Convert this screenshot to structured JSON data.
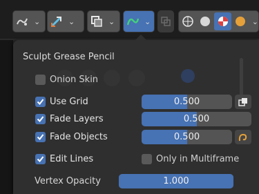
{
  "panel": {
    "title": "Sculpt Grease Pencil",
    "onion_skin": {
      "label": "Onion Skin",
      "checked": false
    },
    "use_grid": {
      "label": "Use Grid",
      "checked": true,
      "value": "0.500",
      "fraction": 0.5
    },
    "fade_layers": {
      "label": "Fade Layers",
      "checked": true,
      "value": "0.500",
      "fraction": 0.5
    },
    "fade_objects": {
      "label": "Fade Objects",
      "checked": true,
      "value": "0.500",
      "fraction": 0.5
    },
    "edit_lines": {
      "label": "Edit Lines",
      "checked": true
    },
    "only_in_multiframe": {
      "label": "Only in Multiframe",
      "checked": false
    },
    "vertex_opacity": {
      "label": "Vertex Opacity",
      "value": "1.000",
      "fraction": 1.0
    }
  },
  "toolbar": {
    "icons": [
      "brush-icon",
      "transform-icon",
      "overlay-icon",
      "grease-pencil-overlay-icon",
      "xray-icon",
      "wireframe-shading-icon",
      "solid-shading-icon",
      "material-shading-icon",
      "rendered-shading-icon"
    ]
  },
  "colors": {
    "accent": "#4772b3",
    "panel": "#2f2f2f",
    "toolbar": "#1d1d1d",
    "field": "#545454",
    "orange": "#e5a03a"
  }
}
